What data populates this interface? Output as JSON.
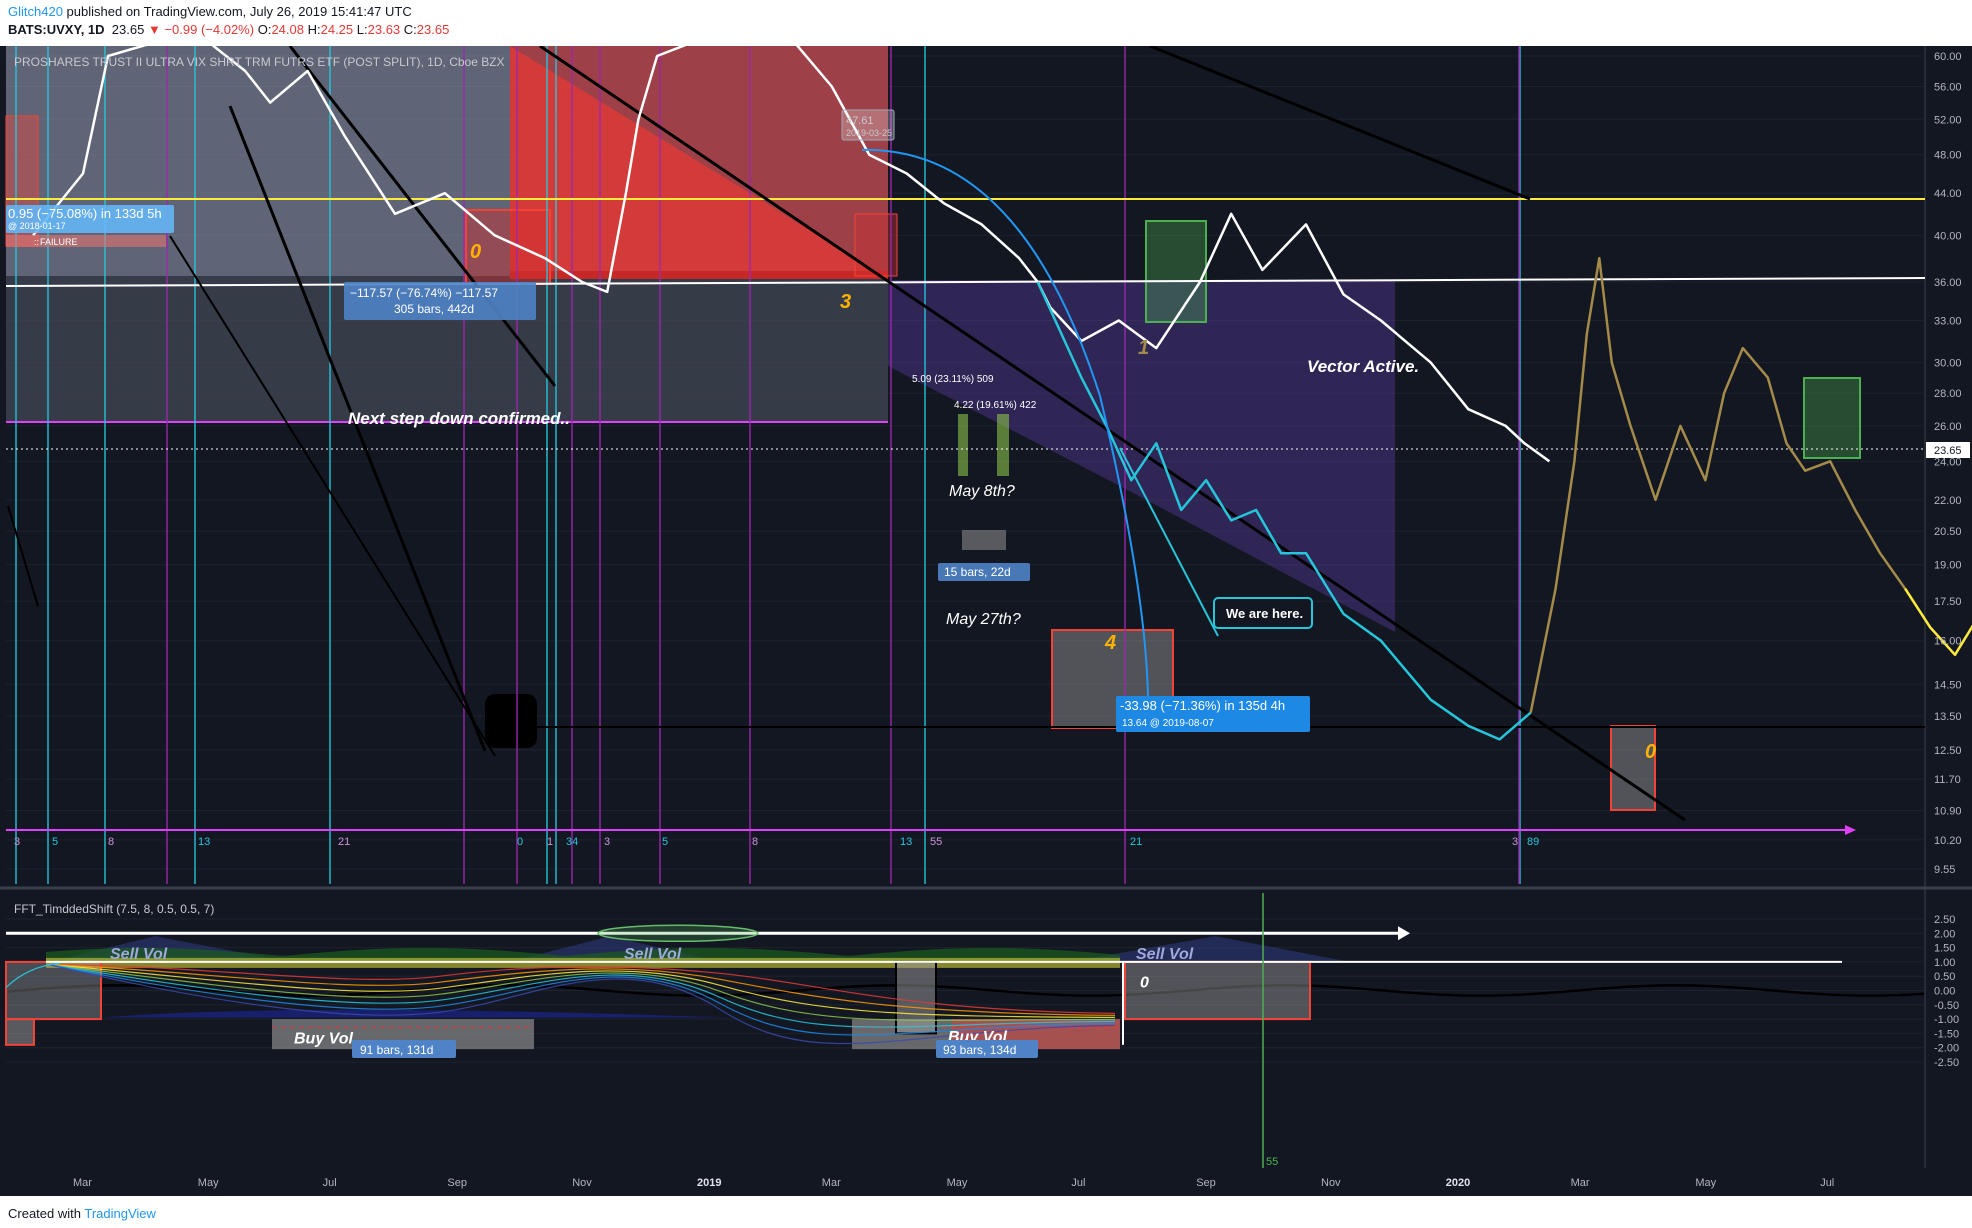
{
  "header": {
    "author": "Glitch420",
    "published": "published on TradingView.com, July 26, 2019 15:41:47 UTC",
    "symbol": "BATS:UVXY, 1D",
    "price": "23.65",
    "change": "▼ −0.99 (−4.02%)",
    "o_label": "O:",
    "o": "24.08",
    "h_label": "H:",
    "h": "24.25",
    "l_label": "L:",
    "l": "23.63",
    "c_label": "C:",
    "c": "23.65"
  },
  "footer": {
    "created": "Created with",
    "brand": "TradingView"
  },
  "chart_data": [
    {
      "type": "line",
      "title": "PROSHARES TRUST II ULTRA VIX SHRT TRM FUTRS ETF (POST SPLIT), 1D, Cboe BZX",
      "y_scale": "log",
      "ylim": [
        9.55,
        60
      ],
      "y_ticks": [
        "60.00",
        "56.00",
        "52.00",
        "48.00",
        "44.00",
        "40.00",
        "36.00",
        "33.00",
        "30.00",
        "28.00",
        "26.00",
        "24.00",
        "22.00",
        "20.50",
        "19.00",
        "17.50",
        "16.00",
        "14.50",
        "13.50",
        "12.50",
        "11.70",
        "10.90",
        "10.20",
        "9.55"
      ],
      "last_price": "23.65",
      "x_ticks": [
        "Mar",
        "May",
        "Jul",
        "Sep",
        "Nov",
        "2019",
        "Mar",
        "May",
        "Jul",
        "Sep",
        "Nov",
        "2020",
        "Mar",
        "May",
        "Jul"
      ],
      "series": [
        {
          "color": "#ffffff",
          "points": [
            [
              -0.4,
              40
            ],
            [
              0,
              46
            ],
            [
              0.2,
              60
            ],
            [
              0.6,
              62
            ],
            [
              1,
              62
            ],
            [
              1.3,
              58
            ],
            [
              1.5,
              54
            ],
            [
              1.8,
              58
            ],
            [
              2.1,
              50
            ],
            [
              2.5,
              42
            ],
            [
              2.9,
              44
            ],
            [
              3.3,
              40
            ],
            [
              3.7,
              38
            ],
            [
              4,
              36
            ],
            [
              4.2,
              35.2
            ],
            [
              4.35,
              44
            ],
            [
              4.45,
              52
            ],
            [
              4.6,
              60
            ],
            [
              4.9,
              62
            ],
            [
              5.2,
              66
            ],
            [
              5.6,
              64
            ],
            [
              6,
              56
            ],
            [
              6.3,
              48
            ],
            [
              6.6,
              46
            ],
            [
              6.9,
              43
            ],
            [
              7.2,
              41
            ],
            [
              7.5,
              38
            ],
            [
              7.65,
              36
            ],
            [
              7.75,
              34
            ],
            [
              8,
              31.5
            ],
            [
              8.3,
              33
            ],
            [
              8.6,
              31
            ],
            [
              8.95,
              36
            ],
            [
              9.2,
              42
            ],
            [
              9.45,
              37
            ],
            [
              9.8,
              41
            ],
            [
              10.1,
              35
            ],
            [
              10.4,
              33
            ],
            [
              10.8,
              30
            ],
            [
              11.1,
              27
            ],
            [
              11.4,
              26
            ],
            [
              11.55,
              25
            ],
            [
              11.75,
              24
            ]
          ]
        },
        {
          "color": "#26c6da",
          "points": [
            [
              7.65,
              36
            ],
            [
              8,
              29
            ],
            [
              8.2,
              26
            ],
            [
              8.4,
              23
            ],
            [
              8.6,
              25
            ],
            [
              8.8,
              21.5
            ],
            [
              9,
              23
            ],
            [
              9.2,
              21
            ],
            [
              9.4,
              21.5
            ],
            [
              9.6,
              19.5
            ],
            [
              9.8,
              19.5
            ],
            [
              10.1,
              17
            ],
            [
              10.4,
              16
            ],
            [
              10.8,
              14
            ],
            [
              11.1,
              13.2
            ],
            [
              11.35,
              12.8
            ],
            [
              11.6,
              13.6
            ]
          ]
        },
        {
          "color": "#a58b4a",
          "points": [
            [
              11.6,
              13.6
            ],
            [
              11.8,
              18
            ],
            [
              11.95,
              24
            ],
            [
              12.05,
              32
            ],
            [
              12.15,
              38
            ],
            [
              12.25,
              30
            ],
            [
              12.4,
              26
            ],
            [
              12.6,
              22
            ],
            [
              12.8,
              26
            ],
            [
              13,
              23
            ],
            [
              13.15,
              28
            ],
            [
              13.3,
              31
            ],
            [
              13.5,
              29
            ],
            [
              13.65,
              25
            ],
            [
              13.8,
              23.5
            ],
            [
              14,
              24
            ],
            [
              14.2,
              21.5
            ],
            [
              14.4,
              19.5
            ],
            [
              14.6,
              18
            ]
          ]
        },
        {
          "color": "#ffeb3b",
          "points": [
            [
              14.6,
              18
            ],
            [
              14.8,
              16.5
            ],
            [
              15,
              15.5
            ],
            [
              15.2,
              17
            ],
            [
              15.4,
              19.5
            ],
            [
              15.55,
              17
            ],
            [
              15.7,
              15.5
            ],
            [
              15.9,
              14.3
            ],
            [
              16.1,
              13.5
            ],
            [
              16.35,
              14.5
            ],
            [
              16.5,
              12.2
            ],
            [
              16.7,
              12.5
            ],
            [
              16.9,
              12
            ],
            [
              17.1,
              11.5
            ],
            [
              17.3,
              13
            ],
            [
              17.45,
              11.5
            ],
            [
              17.6,
              10.9
            ],
            [
              17.8,
              10.5
            ],
            [
              17.95,
              10.4
            ]
          ]
        },
        {
          "color": "#9c27b0",
          "points": [
            [
              17.95,
              10.4
            ],
            [
              18.1,
              11.5
            ],
            [
              18.25,
              16
            ],
            [
              18.4,
              17
            ],
            [
              18.55,
              18
            ],
            [
              18.7,
              16
            ],
            [
              18.9,
              19
            ],
            [
              19.1,
              17.5
            ],
            [
              19.3,
              16.8
            ],
            [
              19.5,
              18.5
            ],
            [
              19.7,
              17
            ],
            [
              19.9,
              20
            ],
            [
              20.1,
              22
            ],
            [
              20.25,
              25
            ],
            [
              20.4,
              23
            ],
            [
              20.6,
              20
            ],
            [
              20.8,
              19
            ],
            [
              21,
              18
            ],
            [
              21.15,
              17
            ],
            [
              21.3,
              15.5
            ]
          ]
        }
      ],
      "annotations": [
        "Next step down confirmed..",
        "Vector Active.",
        "May 8th?",
        "May 27th?",
        "We are here.",
        "3",
        "4",
        "1",
        "0",
        "0",
        "−117.57 (−76.74%) −117.57",
        "305 bars, 442d",
        "15 bars, 22d",
        "-33.98 (−71.36%) in 135d 4h",
        "13.64 @ 2019-08-07",
        "5.09 (23.11%) 509",
        "4.22 (19.61%) 422",
        "47.61",
        "2019-03-25",
        "0.95 (−75.08%) in 133d 5h",
        "@ 2018-01-17",
        "FAILURE"
      ],
      "fib_labels": [
        "3",
        "5",
        "8",
        "13",
        "21",
        "0",
        "1",
        "34",
        "3",
        "5",
        "8",
        "13",
        "55",
        "21",
        "3",
        "89"
      ]
    },
    {
      "type": "line",
      "title": "FFT_TimddedShift (7.5, 8, 0.5, 0.5, 7)",
      "ylim": [
        -2.5,
        2.5
      ],
      "y_ticks": [
        "2.50",
        "2.00",
        "1.50",
        "1.00",
        "0.50",
        "0.00",
        "-0.50",
        "-1.00",
        "-1.50",
        "-2.00",
        "-2.50"
      ],
      "x_ticks": [
        "Mar",
        "May",
        "Jul",
        "Sep",
        "Nov",
        "2019",
        "Mar",
        "May",
        "Jul",
        "Sep",
        "Nov",
        "2020",
        "Mar",
        "May",
        "Jul"
      ],
      "annotations": [
        "Sell Vol",
        "Sell Vol",
        "Sell Vol",
        "Buy Vol",
        "Buy Vol",
        "91 bars, 131d",
        "93 bars, 134d",
        "0",
        "55"
      ]
    }
  ]
}
